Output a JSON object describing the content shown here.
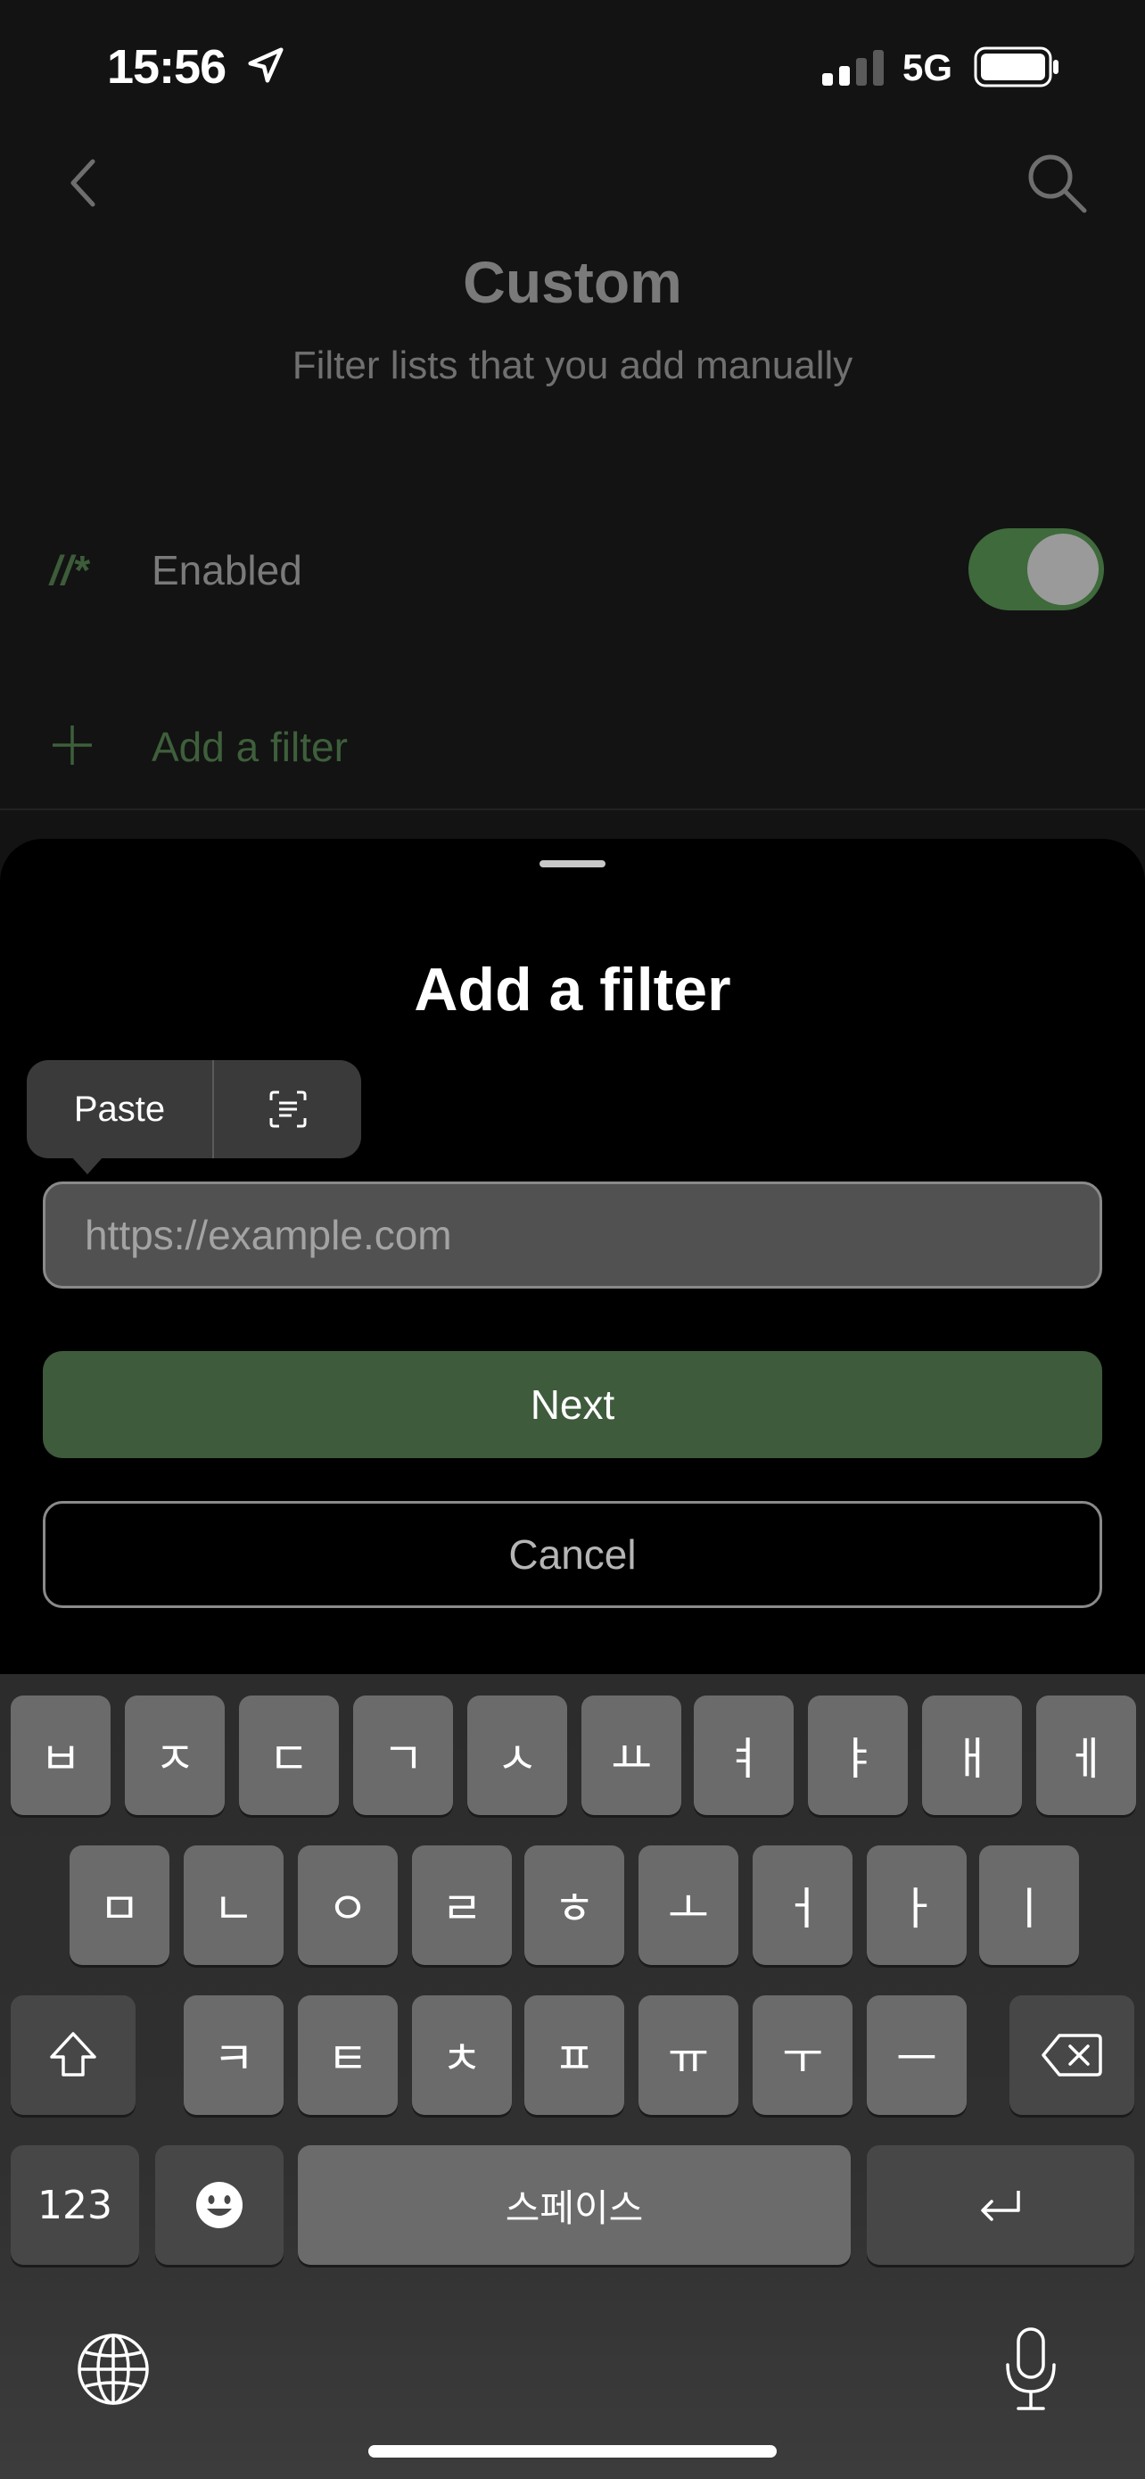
{
  "status_bar": {
    "time": "15:56",
    "network": "5G",
    "icons": [
      "location-arrow-icon",
      "cellular-signal-icon",
      "battery-icon"
    ]
  },
  "page": {
    "title": "Custom",
    "subtitle": "Filter lists that you add manually",
    "enabled_row": {
      "icon_text": "//*",
      "label": "Enabled",
      "toggle_on": true
    },
    "add_row": {
      "label": "Add a filter"
    },
    "icons": [
      "back-chevron-icon",
      "search-icon",
      "plus-icon"
    ]
  },
  "sheet": {
    "title": "Add a filter",
    "url_input": {
      "placeholder": "https://example.com",
      "value": ""
    },
    "next_label": "Next",
    "cancel_label": "Cancel"
  },
  "edit_menu": {
    "paste_label": "Paste",
    "scan_icon": "scan-text-icon"
  },
  "keyboard": {
    "row1": [
      "ㅂ",
      "ㅈ",
      "ㄷ",
      "ㄱ",
      "ㅅ",
      "ㅛ",
      "ㅕ",
      "ㅑ",
      "ㅐ",
      "ㅔ"
    ],
    "row2": [
      "ㅁ",
      "ㄴ",
      "ㅇ",
      "ㄹ",
      "ㅎ",
      "ㅗ",
      "ㅓ",
      "ㅏ",
      "ㅣ"
    ],
    "row3": [
      "ㅋ",
      "ㅌ",
      "ㅊ",
      "ㅍ",
      "ㅠ",
      "ㅜ",
      "ㅡ"
    ],
    "numbers_label": "123",
    "space_label": "스페이스",
    "icons": [
      "shift-icon",
      "delete-icon",
      "emoji-icon",
      "return-icon",
      "globe-icon",
      "microphone-icon"
    ]
  },
  "colors": {
    "accent_green": "#3e5b3c",
    "sheet_bg": "#000000",
    "page_bg": "#131313"
  }
}
